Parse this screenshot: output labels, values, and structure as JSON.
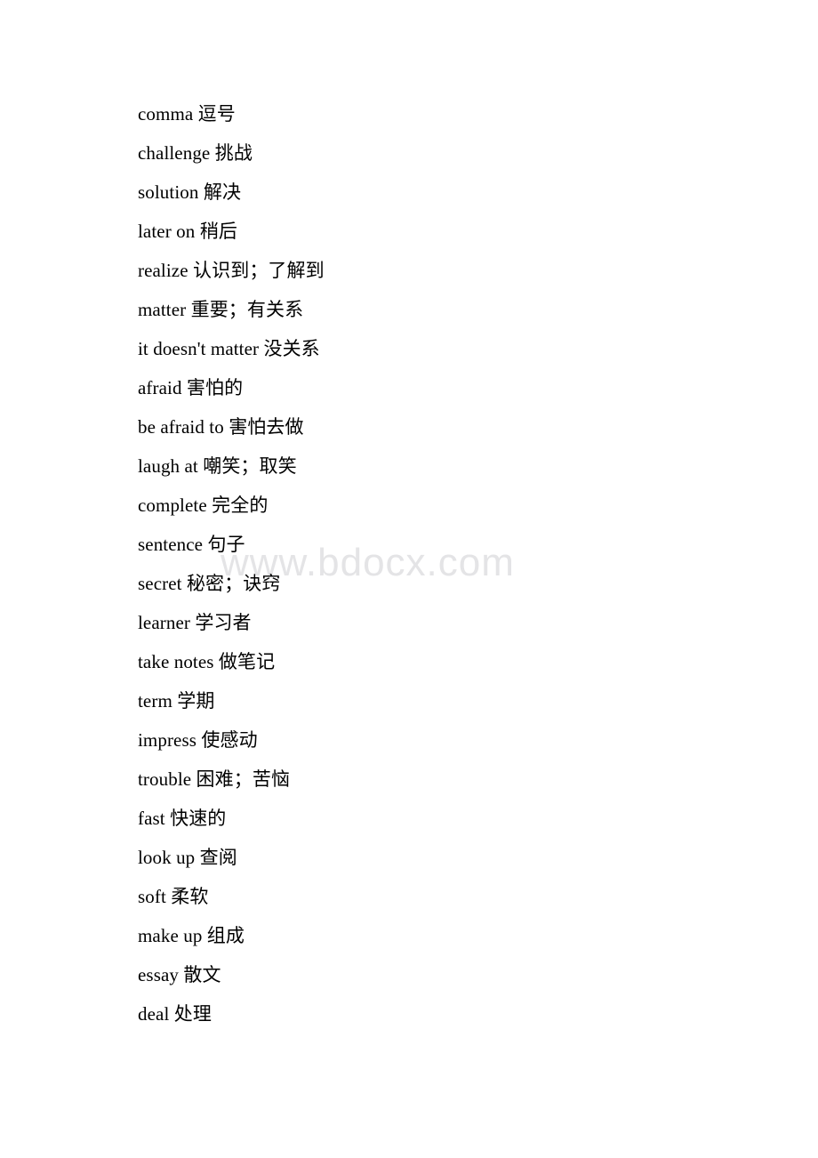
{
  "document": {
    "type": "vocabulary-list",
    "language_pair": "English-Chinese",
    "background_color": "#ffffff",
    "text_color": "#000000"
  },
  "watermark": {
    "text": "www.bdocx.com",
    "color": "#e4e4e6"
  },
  "lines": [
    {
      "term": "comma",
      "gloss": "逗号"
    },
    {
      "term": "challenge",
      "gloss": "挑战"
    },
    {
      "term": "solution",
      "gloss": "解决"
    },
    {
      "term": "later on",
      "gloss": "稍后"
    },
    {
      "term": "realize",
      "gloss": "认识到；了解到"
    },
    {
      "term": "matter",
      "gloss": "重要；有关系"
    },
    {
      "term": "it doesn't matter",
      "gloss": "没关系"
    },
    {
      "term": "afraid",
      "gloss": "害怕的"
    },
    {
      "term": "be afraid to",
      "gloss": "害怕去做"
    },
    {
      "term": "laugh at",
      "gloss": "嘲笑；取笑"
    },
    {
      "term": "complete",
      "gloss": "完全的"
    },
    {
      "term": "sentence",
      "gloss": "句子"
    },
    {
      "term": "secret",
      "gloss": "秘密；诀窍"
    },
    {
      "term": "learner",
      "gloss": "学习者"
    },
    {
      "term": "take notes",
      "gloss": "做笔记"
    },
    {
      "term": "term",
      "gloss": "学期"
    },
    {
      "term": "impress",
      "gloss": "使感动"
    },
    {
      "term": "trouble",
      "gloss": "困难；苦恼"
    },
    {
      "term": "fast",
      "gloss": "快速的"
    },
    {
      "term": "look up",
      "gloss": "查阅"
    },
    {
      "term": "soft",
      "gloss": "柔软"
    },
    {
      "term": "make up",
      "gloss": "组成"
    },
    {
      "term": "essay",
      "gloss": "散文"
    },
    {
      "term": "deal",
      "gloss": "处理"
    }
  ]
}
